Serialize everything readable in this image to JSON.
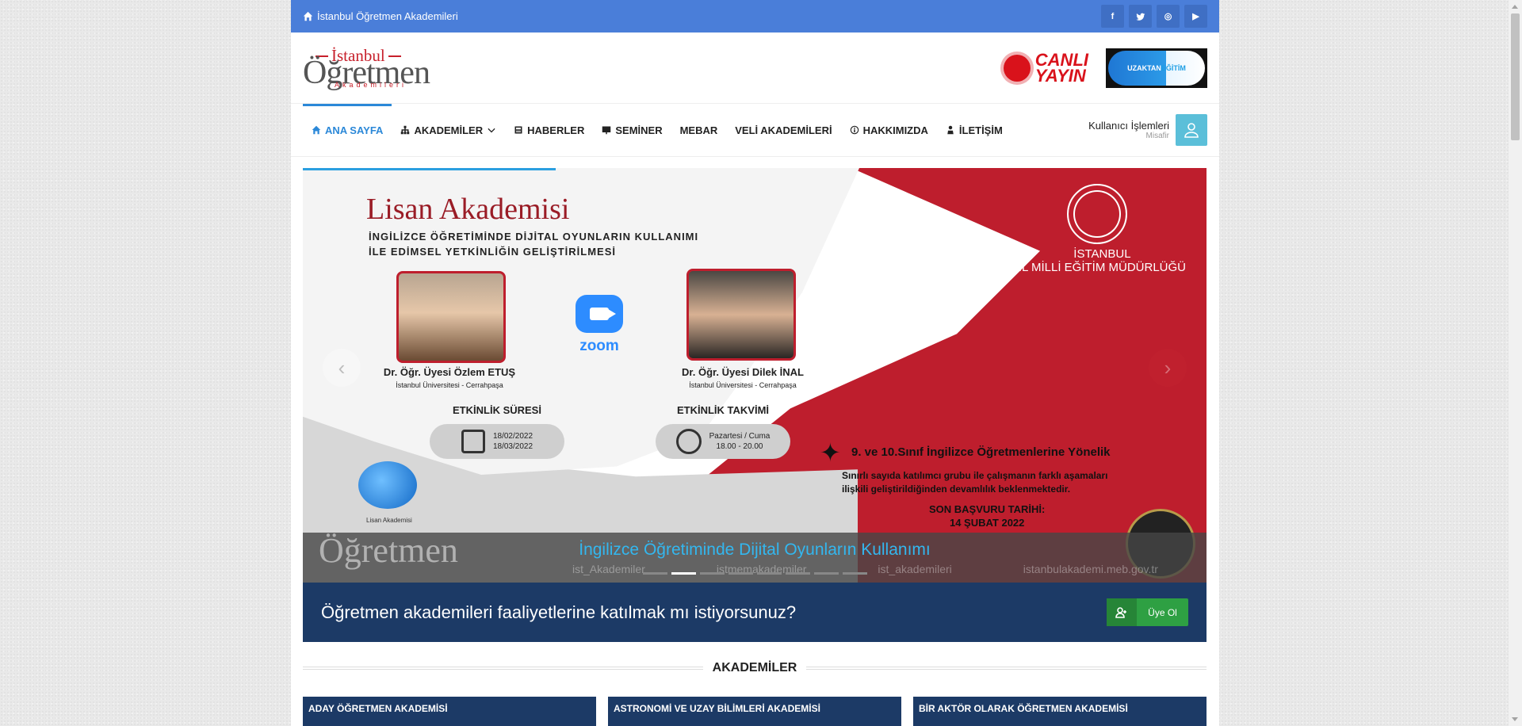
{
  "colors": {
    "topbar": "#4a7ed9",
    "accent": "#2b88d8",
    "navy": "#1c3a66",
    "green": "#2ea043",
    "brand_red": "#c7202b"
  },
  "topbar": {
    "site_name": "İstanbul Öğretmen Akademileri",
    "home_icon": "home-icon",
    "socials": [
      {
        "name": "facebook",
        "glyph": "f"
      },
      {
        "name": "twitter",
        "glyph": "t"
      },
      {
        "name": "instagram",
        "glyph": "◎"
      },
      {
        "name": "youtube",
        "glyph": "▶"
      }
    ]
  },
  "header": {
    "logo": {
      "top": "İstanbul",
      "main": "Öğretmen",
      "bottom": "Akademileri"
    },
    "live": {
      "line1": "CANLI",
      "line2": "YAYIN"
    },
    "remote": {
      "part1": "UZAKTAN",
      "part2": "EĞİTİM"
    }
  },
  "nav": {
    "items": [
      {
        "label": "ANA SAYFA",
        "icon": "home-icon",
        "active": true
      },
      {
        "label": "AKADEMİLER",
        "icon": "sitemap-icon",
        "dropdown": true
      },
      {
        "label": "HABERLER",
        "icon": "newspaper-icon"
      },
      {
        "label": "SEMİNER",
        "icon": "presentation-icon"
      },
      {
        "label": "MEBAR",
        "icon": ""
      },
      {
        "label": "VELİ AKADEMİLERİ",
        "icon": ""
      },
      {
        "label": "HAKKIMIZDA",
        "icon": "info-icon"
      },
      {
        "label": "İLETİŞİM",
        "icon": "contact-icon"
      }
    ],
    "user": {
      "title": "Kullanıcı İşlemleri",
      "subtitle": "Misafir"
    }
  },
  "slider": {
    "caption": "İngilizce Öğretiminde Dijital Oyunların Kullanımı",
    "total_slides": 8,
    "active_slide": 2,
    "progress": 0.28,
    "slide": {
      "title": "Lisan Akademisi",
      "subtitle_line1": "İNGİLİZCE ÖĞRETİMİNDE DİJİTAL OYUNLARIN KULLANIMI",
      "subtitle_line2": "İLE EDİMSEL YETKİNLİĞİN GELİŞTİRİLMESİ",
      "zoom": "zoom",
      "person1": {
        "name": "Dr. Öğr. Üyesi Özlem ETUŞ",
        "org": "İstanbul Üniversitesi - Cerrahpaşa"
      },
      "person2": {
        "name": "Dr. Öğr. Üyesi Dilek İNAL",
        "org": "İstanbul Üniversitesi - Cerrahpaşa"
      },
      "duration": {
        "label": "ETKİNLİK SÜRESİ",
        "start": "18/02/2022",
        "end": "18/03/2022"
      },
      "schedule": {
        "label": "ETKİNLİK TAKVİMİ",
        "days": "Pazartesi / Cuma",
        "hours": "18.00 - 20.00"
      },
      "province": {
        "line1": "İSTANBUL",
        "line2": "İL MİLLİ EĞİTİM MÜDÜRLÜĞÜ"
      },
      "target": "9. ve 10.Sınıf İngilizce Öğretmenlerine Yönelik",
      "desc_line1": "Sınırlı sayıda katılımcı grubu ile çalışmanın farklı aşamaları",
      "desc_line2": "ilişkili geliştirildiğinden devamlılık beklenmektedir.",
      "deadline_label": "SON BAŞVURU TARİHİ:",
      "deadline_date": "14 ŞUBAT 2022",
      "lisan_logo_label": "Lisan Akademisi",
      "handles": [
        "ist_Akademiler",
        "istmemakademiler",
        "ist_akademileri"
      ],
      "website": "istanbulakademi.meb.gov.tr"
    }
  },
  "cta": {
    "question": "Öğretmen akademileri faaliyetlerine katılmak mı istiyorsunuz?",
    "button": "Üye Ol"
  },
  "section": {
    "title": "AKADEMİLER"
  },
  "cards": [
    "ADAY ÖĞRETMEN AKADEMİSİ",
    "ASTRONOMİ VE UZAY BİLİMLERİ AKADEMİSİ",
    "BİR AKTÖR OLARAK ÖĞRETMEN AKADEMİSİ"
  ]
}
